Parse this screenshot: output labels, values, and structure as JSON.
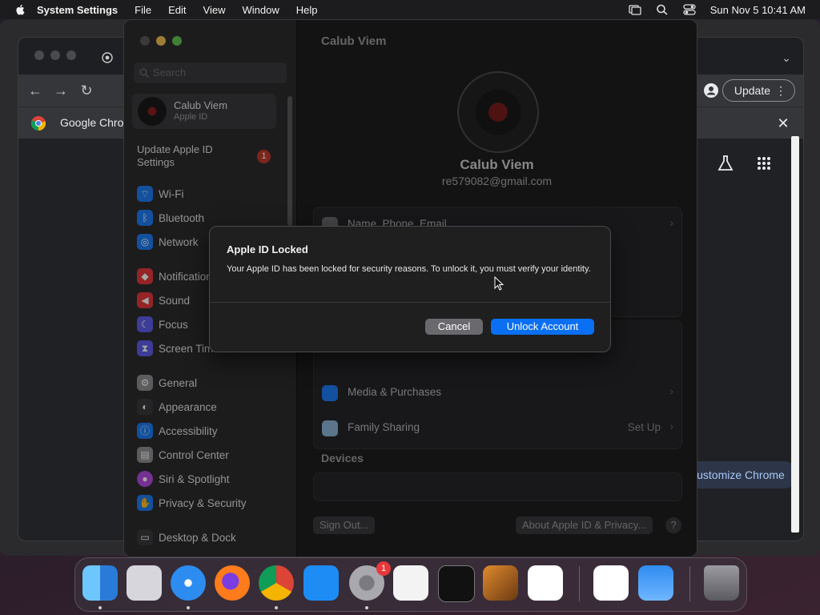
{
  "menubar": {
    "app": "System Settings",
    "items": [
      "File",
      "Edit",
      "View",
      "Window",
      "Help"
    ],
    "datetime": "Sun Nov 5  10:41 AM"
  },
  "chrome": {
    "tab_title": "Google Chrome",
    "update_label": "Update",
    "customize_label": "Customize Chrome"
  },
  "settings": {
    "search_placeholder": "Search",
    "account_name": "Calub Viem",
    "account_sub": "Apple ID",
    "update_apple_id": "Update Apple ID Settings",
    "update_badge": "1",
    "sidebar_items": [
      {
        "label": "Wi-Fi",
        "icon": "wifi-icon",
        "color": "#1e7cf2"
      },
      {
        "label": "Bluetooth",
        "icon": "bluetooth-icon",
        "color": "#1e7cf2"
      },
      {
        "label": "Network",
        "icon": "globe-icon",
        "color": "#1e7cf2"
      },
      {
        "label": "Notifications",
        "icon": "bell-icon",
        "color": "#e5383b"
      },
      {
        "label": "Sound",
        "icon": "speaker-icon",
        "color": "#e5383b"
      },
      {
        "label": "Focus",
        "icon": "moon-icon",
        "color": "#5e5ce6"
      },
      {
        "label": "Screen Time",
        "icon": "hourglass-icon",
        "color": "#5e5ce6"
      },
      {
        "label": "General",
        "icon": "gear-icon",
        "color": "#8e8e93"
      },
      {
        "label": "Appearance",
        "icon": "appearance-icon",
        "color": "#3a3a3c"
      },
      {
        "label": "Accessibility",
        "icon": "accessibility-icon",
        "color": "#1e7cf2"
      },
      {
        "label": "Control Center",
        "icon": "control-center-icon",
        "color": "#8e8e93"
      },
      {
        "label": "Siri & Spotlight",
        "icon": "siri-icon",
        "color": "#b54ae0"
      },
      {
        "label": "Privacy & Security",
        "icon": "hand-icon",
        "color": "#1e7cf2"
      },
      {
        "label": "Desktop & Dock",
        "icon": "dock-icon",
        "color": "#3a3a3c"
      }
    ],
    "main": {
      "title": "Calub Viem",
      "name": "Calub Viem",
      "email": "re579082@gmail.com",
      "rows": [
        {
          "label": "Name, Phone, Email",
          "value": ""
        },
        {
          "label": "Media & Purchases",
          "value": ""
        },
        {
          "label": "Family Sharing",
          "value": "Set Up"
        }
      ],
      "devices_header": "Devices",
      "sign_out": "Sign Out...",
      "about": "About Apple ID & Privacy...",
      "help": "?"
    }
  },
  "dialog": {
    "title": "Apple ID Locked",
    "message": "Your Apple ID has been locked for security reasons. To unlock it, you must verify your identity.",
    "cancel": "Cancel",
    "confirm": "Unlock Account"
  },
  "dock": {
    "apps": [
      "finder-icon",
      "launchpad-icon",
      "safari-icon",
      "firefox-icon",
      "chrome-icon",
      "app-store-icon",
      "system-settings-icon",
      "textedit-icon",
      "terminal-icon",
      "garageband-icon",
      "vscode-icon",
      "visual-studio-icon",
      "weather-icon",
      "trash-icon"
    ],
    "settings_badge": "1"
  }
}
